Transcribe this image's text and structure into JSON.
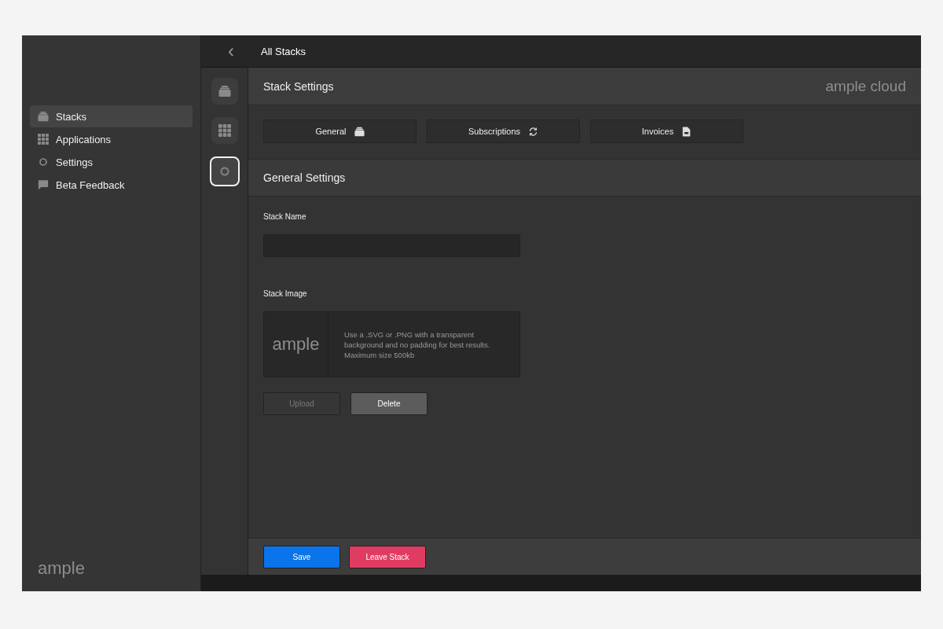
{
  "sidebar": {
    "items": [
      {
        "label": "Stacks",
        "kind": "stack",
        "selected": true
      },
      {
        "label": "Applications",
        "kind": "grid",
        "selected": false
      },
      {
        "label": "Settings",
        "kind": "gear",
        "selected": false
      },
      {
        "label": "Beta Feedback",
        "kind": "chat",
        "selected": false
      }
    ],
    "logo": "ample"
  },
  "top_bar": {
    "back": "‹",
    "title": "All Stacks"
  },
  "rail": [
    {
      "kind": "stack",
      "selected": false
    },
    {
      "kind": "grid",
      "selected": false
    },
    {
      "kind": "gear",
      "selected": true
    }
  ],
  "header": {
    "title": "Stack Settings",
    "brand": "ample cloud"
  },
  "tabs": [
    {
      "label": "General",
      "kind": "stack"
    },
    {
      "label": "Subscriptions",
      "kind": "refresh"
    },
    {
      "label": "Invoices",
      "kind": "doc"
    }
  ],
  "section_title": "General Settings",
  "stack_name": {
    "label": "Stack Name"
  },
  "stack_image": {
    "label": "Stack Image",
    "preview": "ample",
    "hint": "Use a .SVG or .PNG with a transparent background and no padding for best results. Maximum size 500kb"
  },
  "image_buttons": [
    {
      "label": "Upload",
      "disabled": true
    },
    {
      "label": "Delete",
      "disabled": false
    }
  ],
  "footer_buttons": [
    {
      "label": "Save",
      "kind": "primary"
    },
    {
      "label": "Leave Stack",
      "kind": "danger"
    }
  ]
}
